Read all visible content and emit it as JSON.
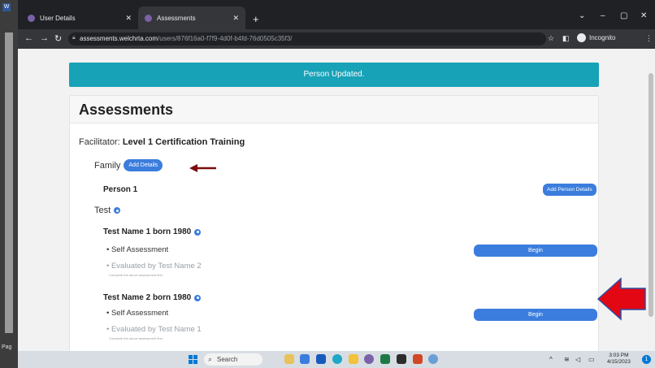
{
  "browser": {
    "tabs": [
      {
        "label": "User Details"
      },
      {
        "label": "Assessments"
      }
    ],
    "url_host": "assessments.welchrta.com",
    "url_path": "/users/876f16a0-f7f9-4d0f-b4fd-76d0505c35f3/",
    "incognito_label": "Incognito"
  },
  "host_app": {
    "page_label": "Pag"
  },
  "page": {
    "alert": "Person Updated.",
    "title": "Assessments",
    "facilitator_label": "Facilitator:",
    "facilitator_value": "Level 1 Certification Training",
    "family_label": "Family",
    "add_details_label": "Add Details",
    "person_label": "Person 1",
    "add_person_details_label": "Add Person Details",
    "test_label": "Test",
    "test_subjects": [
      {
        "name": "Test Name 1 born 1980",
        "self_assessment": "• Self Assessment",
        "begin_label": "Begin",
        "evaluated_by": "• Evaluated by Test Name 2",
        "hint": "Complete the above assessment first"
      },
      {
        "name": "Test Name 2 born 1980",
        "self_assessment": "• Self Assessment",
        "begin_label": "Begin",
        "evaluated_by": "• Evaluated by Test Name 1",
        "hint": "Complete the above assessment first"
      }
    ]
  },
  "annotation_colors": {
    "arrow_dark": "#7b0d0d",
    "arrow_red": "#e30613",
    "accent": "#3b7ddd",
    "alert_bg": "#17a2b8"
  },
  "taskbar": {
    "search_label": "Search",
    "time": "3:03 PM",
    "date": "4/15/2023",
    "notification_count": "1"
  }
}
